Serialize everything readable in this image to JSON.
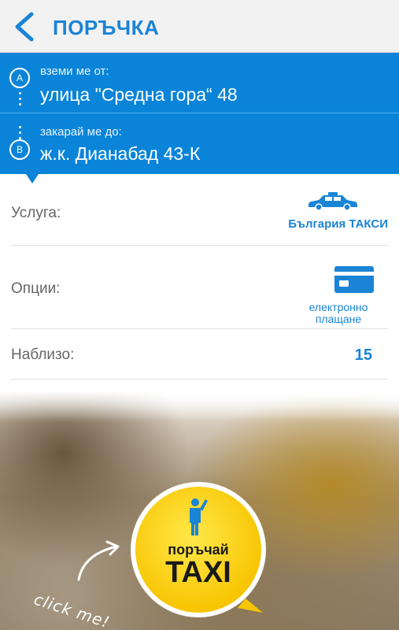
{
  "header": {
    "title": "ПОРЪЧКА",
    "back_icon": "chevron-left-icon"
  },
  "route": {
    "from": {
      "marker": "A",
      "label": "вземи ме от:",
      "address": "улица \"Средна гора“ 48"
    },
    "to": {
      "marker": "B",
      "label": "закарай ме до:",
      "address": "ж.к. Дианабад 43-К"
    }
  },
  "details": {
    "service": {
      "label": "Услуга:",
      "icon": "taxi-car-icon",
      "value": "България ТАКСИ"
    },
    "options": {
      "label": "Опции:",
      "icon": "credit-card-icon",
      "value_line1": "електронно",
      "value_line2": "плащане"
    },
    "nearby": {
      "label": "Наблизо:",
      "value": "15"
    }
  },
  "cta": {
    "line1": "поръчай",
    "line2": "TAXI",
    "icon": "person-hailing-icon",
    "hint": "click me!"
  },
  "colors": {
    "accent": "#0a84d8",
    "text_blue": "#1a84d6",
    "button_yellow": "#ffd400"
  }
}
